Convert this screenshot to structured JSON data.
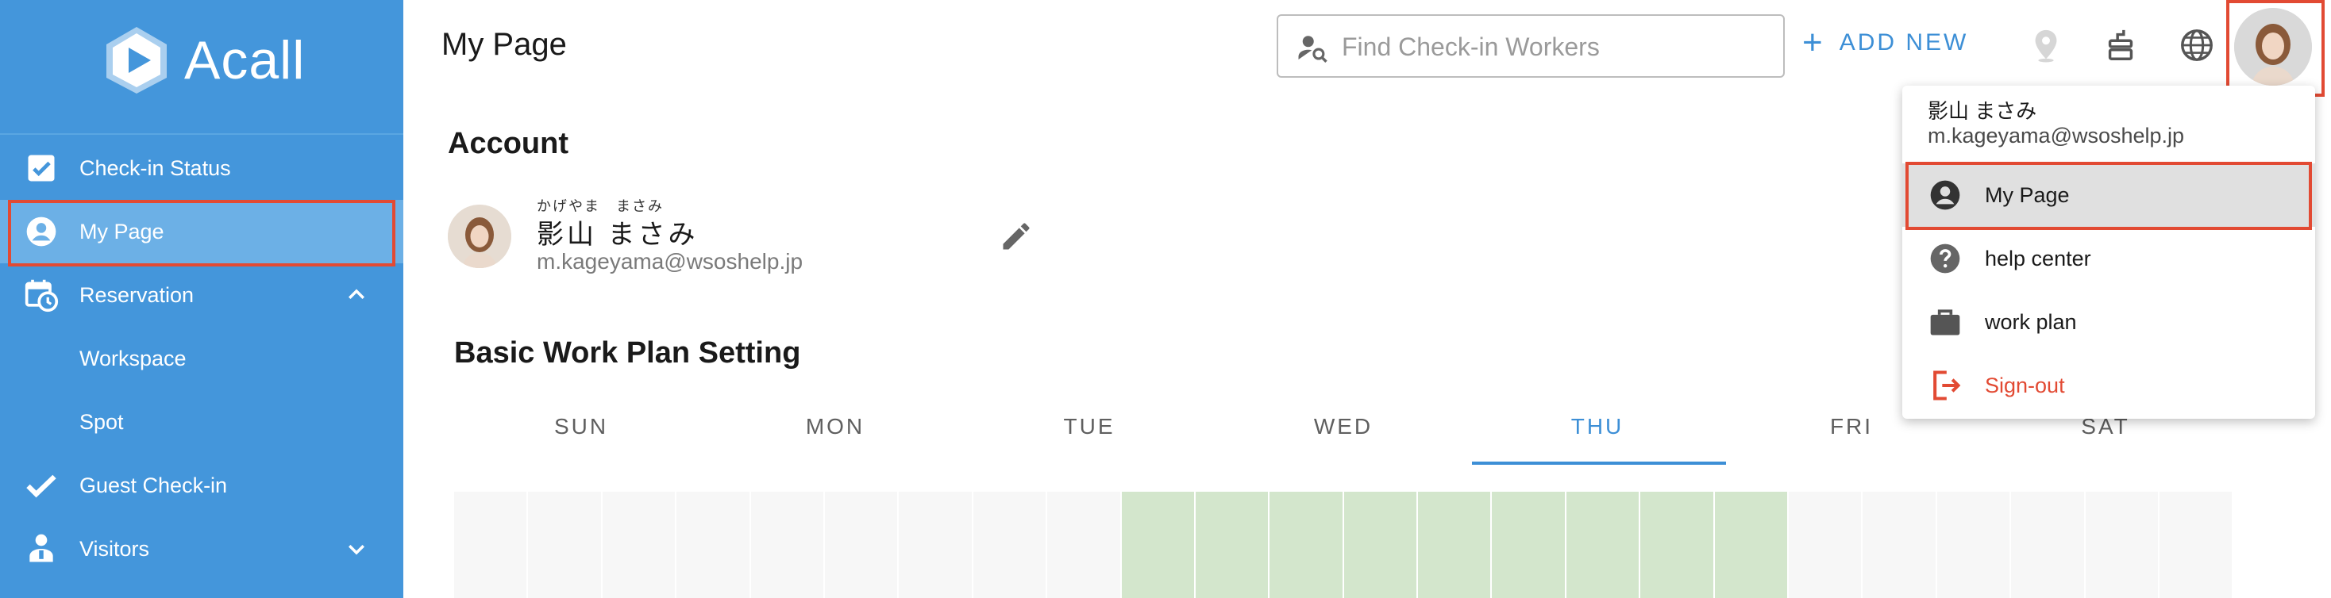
{
  "app": {
    "logo_text": "Acall"
  },
  "sidebar": {
    "items": [
      {
        "label": "Check-in Status",
        "icon": "checkbox-icon"
      },
      {
        "label": "My Page",
        "icon": "account-circle-icon",
        "active": true
      },
      {
        "label": "Reservation",
        "icon": "calendar-clock-icon",
        "expanded": true
      },
      {
        "label": "Workspace",
        "sub": true
      },
      {
        "label": "Spot",
        "sub": true
      },
      {
        "label": "Guest Check-in",
        "icon": "check-icon"
      },
      {
        "label": "Visitors",
        "icon": "visitor-icon",
        "expanded": false
      }
    ]
  },
  "header": {
    "title": "My Page",
    "search_placeholder": "Find Check-in Workers",
    "add_new_label": "ADD NEW"
  },
  "account": {
    "section_title": "Account",
    "name_ruby": "かげやま　まさみ",
    "name": "影山 まさみ",
    "email": "m.kageyama@wsoshelp.jp"
  },
  "work_plan": {
    "section_title": "Basic Work Plan Setting",
    "days": [
      "SUN",
      "MON",
      "TUE",
      "WED",
      "THU",
      "FRI",
      "SAT"
    ],
    "selected_day": "THU",
    "grid_colors": {
      "empty": "#f7f7f7",
      "planned": "#d3e6cc"
    }
  },
  "user_menu": {
    "name": "影山 まさみ",
    "email": "m.kageyama@wsoshelp.jp",
    "items": [
      {
        "label": "My Page",
        "icon": "account-circle-icon",
        "selected": true
      },
      {
        "label": "help center",
        "icon": "help-circle-icon"
      },
      {
        "label": "work plan",
        "icon": "briefcase-icon"
      },
      {
        "label": "Sign-out",
        "icon": "sign-out-icon"
      }
    ]
  },
  "colors": {
    "sidebar_bg": "#4496db",
    "accent": "#3d8fd6",
    "highlight_border": "#e24a33",
    "signout": "#e24a33"
  }
}
